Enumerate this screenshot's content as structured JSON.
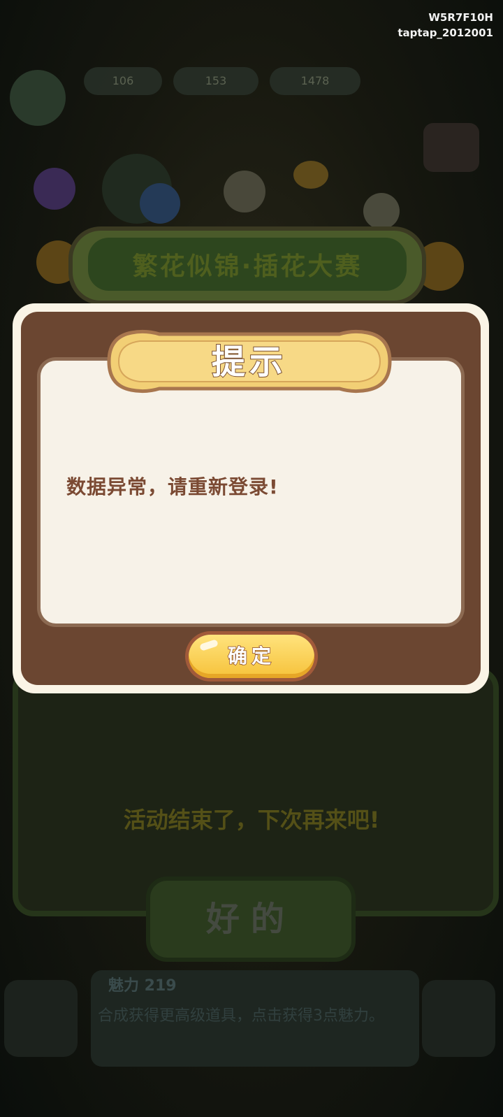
{
  "watermark": {
    "line1": "W5R7F10H",
    "line2": "taptap_2012001"
  },
  "background": {
    "currency": [
      "106",
      "153",
      "1478"
    ],
    "banner_title": "繁花似锦·插花大赛",
    "event_message": "活动结束了，下次再来吧!",
    "ok_button": "好的",
    "tip_title": "魅力 219",
    "tip_text": "合成获得更高级道具，点击获得3点魅力。"
  },
  "dialog": {
    "title": "提示",
    "message": "数据异常，请重新登录!",
    "confirm_label": "确定"
  },
  "colors": {
    "dialog_frame": "#6b4631",
    "dialog_content": "#f7f2e8",
    "message_text": "#7b4a33",
    "confirm_button": "#f6c23a"
  }
}
